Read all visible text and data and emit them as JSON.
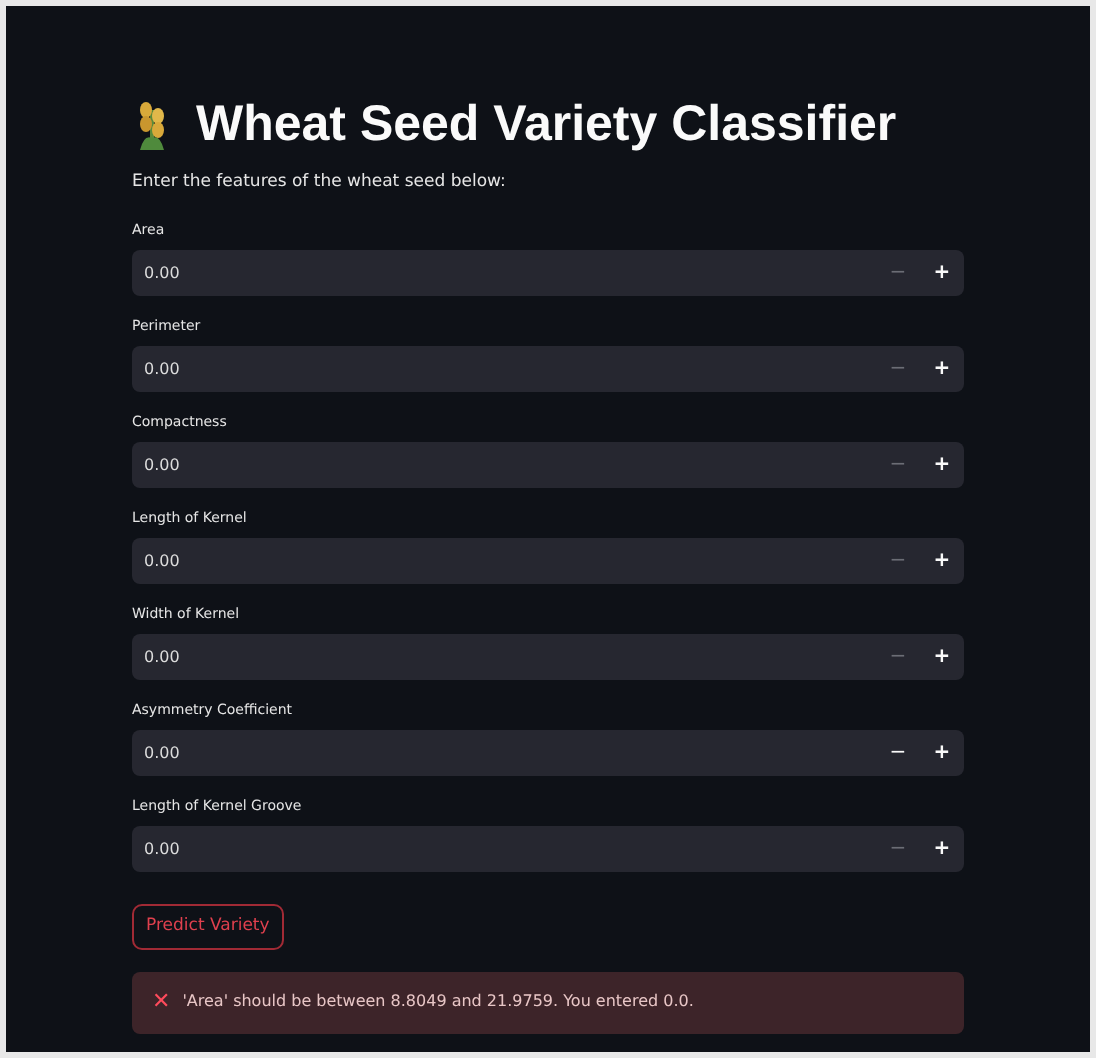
{
  "title": "Wheat Seed Variety Classifier",
  "intro": "Enter the features of the wheat seed below:",
  "fields": [
    {
      "label": "Area",
      "value": "0.00",
      "decrement_active": false
    },
    {
      "label": "Perimeter",
      "value": "0.00",
      "decrement_active": false
    },
    {
      "label": "Compactness",
      "value": "0.00",
      "decrement_active": false
    },
    {
      "label": "Length of Kernel",
      "value": "0.00",
      "decrement_active": false
    },
    {
      "label": "Width of Kernel",
      "value": "0.00",
      "decrement_active": false
    },
    {
      "label": "Asymmetry Coefficient",
      "value": "0.00",
      "decrement_active": true
    },
    {
      "label": "Length of Kernel Groove",
      "value": "0.00",
      "decrement_active": false
    }
  ],
  "steppers": {
    "minus": "−",
    "plus": "+"
  },
  "button": "Predict Variety",
  "error": {
    "icon": "✕",
    "message": "'Area' should be between 8.8049 and 21.9759. You entered 0.0."
  }
}
